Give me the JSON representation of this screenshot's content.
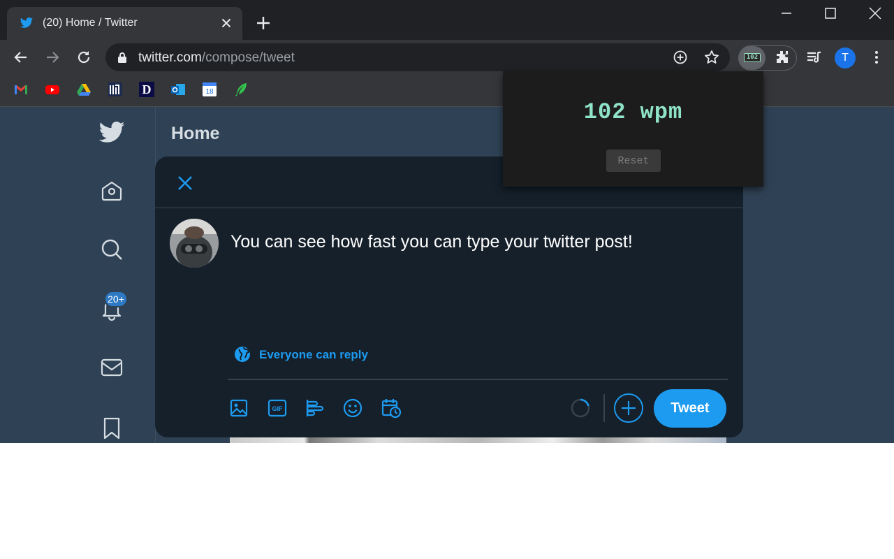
{
  "browser": {
    "tab": {
      "title": "(20) Home / Twitter",
      "favicon": "twitter-bird-icon"
    },
    "omnibox": {
      "url_host": "twitter.com",
      "url_path": "/compose/tweet"
    },
    "profile_initial": "T",
    "extension_badge": "102",
    "bookmarks": [
      "gmail-icon",
      "youtube-icon",
      "google-drive-icon",
      "bookmark-pillars-icon",
      "bookmark-d-icon",
      "outlook-icon",
      "calendar-icon",
      "feather-icon"
    ],
    "bookmark_calendar_day": "18"
  },
  "twitter": {
    "page_title": "Home",
    "notifications_badge": "20+",
    "compose": {
      "text": "You can see how fast you can type your twitter post!",
      "reply_setting": "Everyone can reply",
      "tweet_button": "Tweet",
      "tools": [
        "media-icon",
        "gif-icon",
        "poll-icon",
        "emoji-icon",
        "schedule-icon"
      ]
    }
  },
  "wpm_popup": {
    "wpm_text": "102 wpm",
    "reset_label": "Reset"
  },
  "colors": {
    "accent": "#1d9bf0",
    "modal_bg": "#15202b",
    "page_bg": "#2f4255",
    "wpm_green": "#8fe3c8"
  }
}
